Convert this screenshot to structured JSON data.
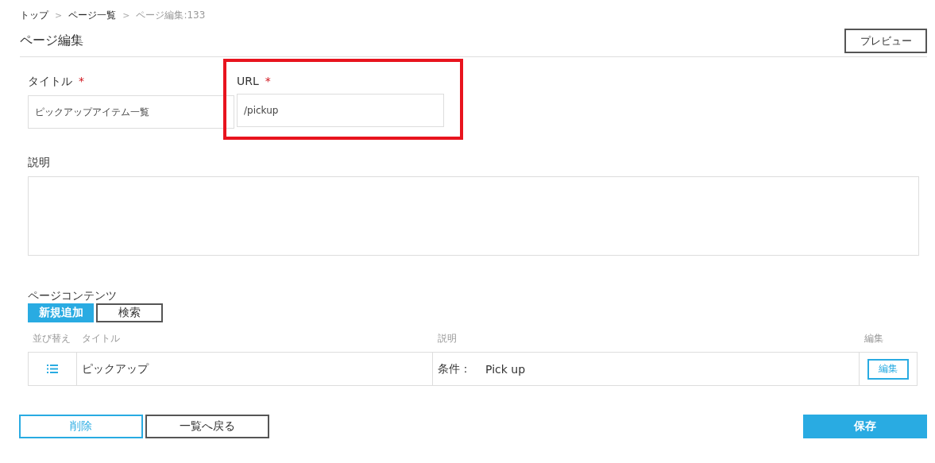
{
  "breadcrumb": [
    {
      "label": "トップ",
      "current": false
    },
    {
      "label": "ページ一覧",
      "current": false
    },
    {
      "label": "ページ編集:133",
      "current": true
    }
  ],
  "breadcrumb_separator": ">",
  "page_title": "ページ編集",
  "preview_button": "プレビュー",
  "fields": [
    {
      "label": "タイトル",
      "required": true,
      "value": "ピックアップアイテム一覧",
      "highlighted": false
    },
    {
      "label": "URL",
      "required": true,
      "value": "/pickup",
      "highlighted": true
    }
  ],
  "required_mark": "*",
  "description": {
    "label": "説明"
  },
  "contents": {
    "label": "ページコンテンツ",
    "add_button": "新規追加",
    "search_button": "検索",
    "columns": [
      "並び替え",
      "タイトル",
      "説明",
      "編集"
    ],
    "rows": [
      {
        "title": "ピックアップ",
        "condition_label": "条件：",
        "condition_value": "Pick up",
        "edit_button": "編集"
      }
    ]
  },
  "footer": {
    "delete_button": "削除",
    "back_button": "一覧へ戻る",
    "save_button": "保存"
  }
}
